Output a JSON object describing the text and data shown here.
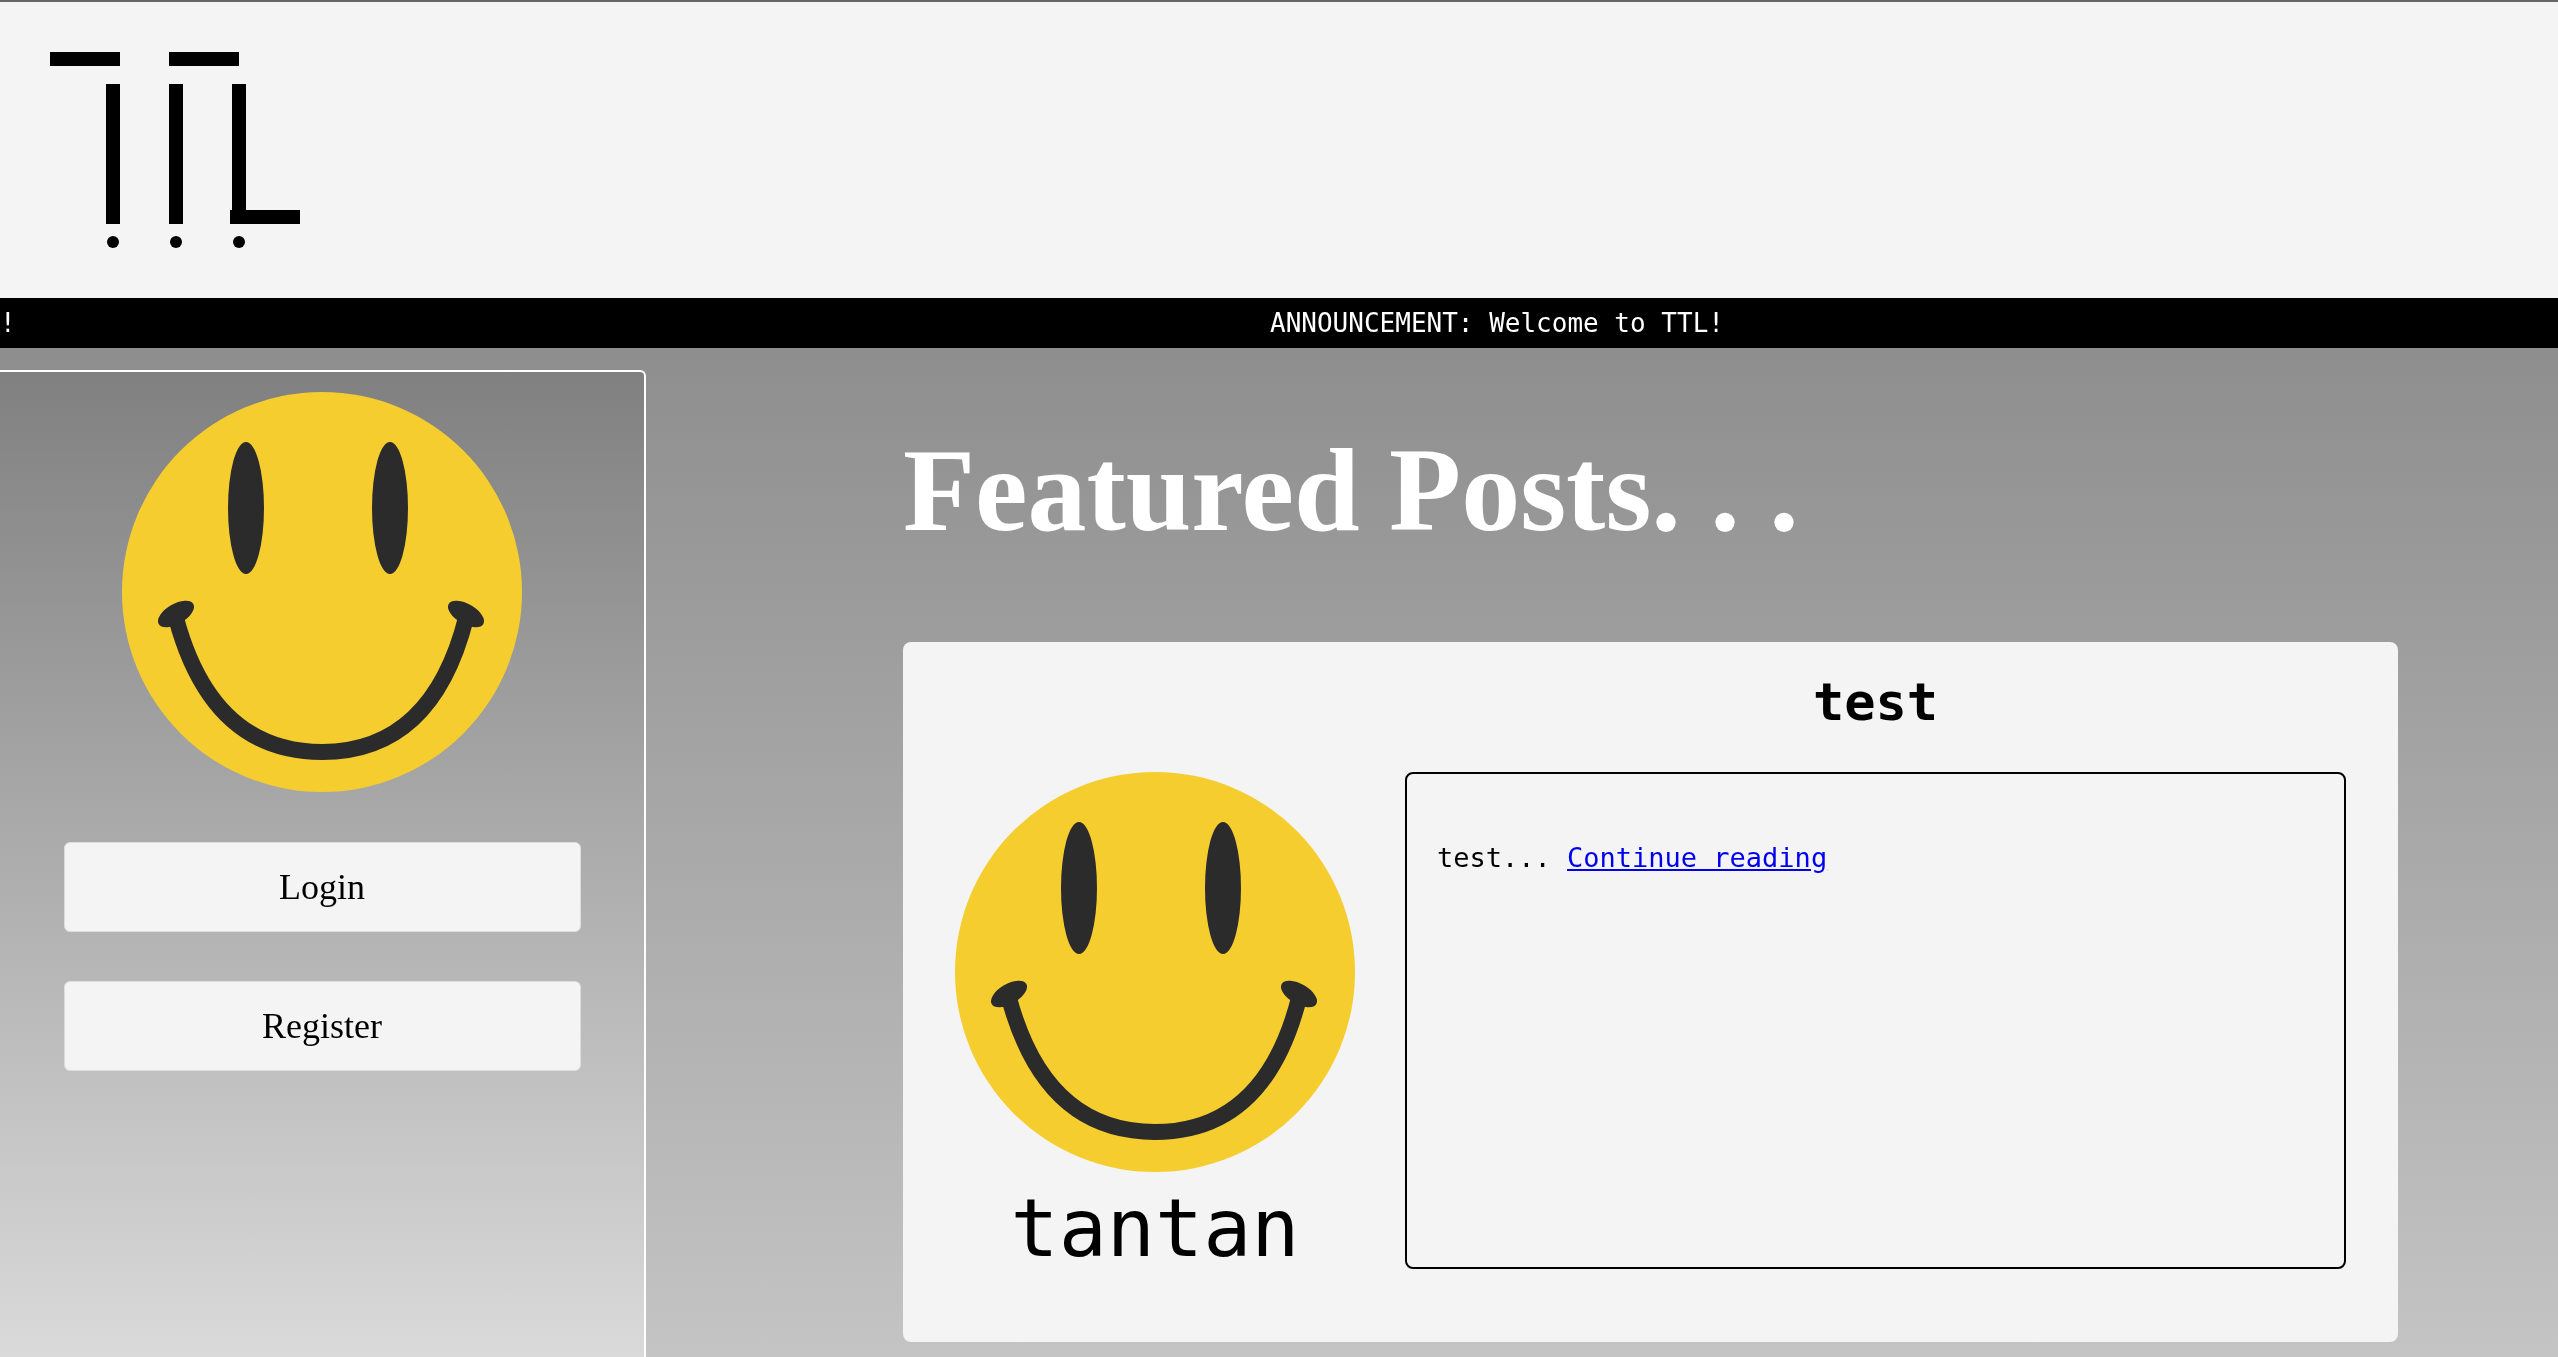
{
  "ticker": {
    "trailing_text": "!",
    "text": "ANNOUNCEMENT: Welcome to TTL!"
  },
  "sidebar": {
    "buttons": [
      "Login",
      "Register"
    ]
  },
  "main": {
    "heading": "Featured Posts. . .",
    "posts": [
      {
        "title": "test",
        "author": "tantan",
        "excerpt": "test...",
        "link": "Continue reading"
      }
    ]
  }
}
